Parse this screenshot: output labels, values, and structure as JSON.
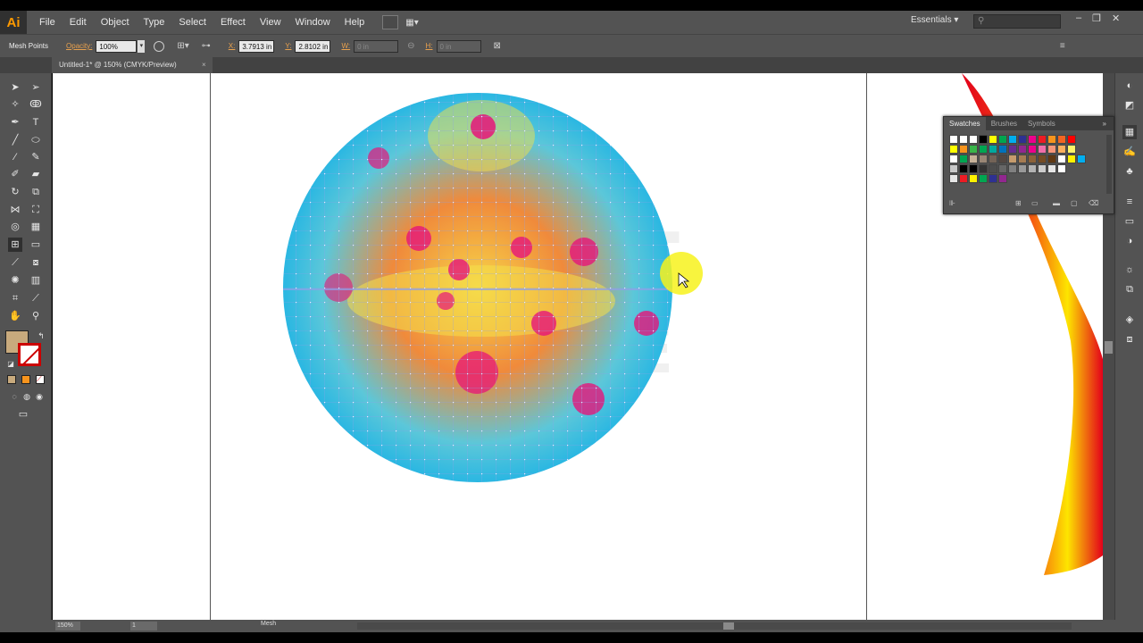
{
  "app": {
    "logo": "Ai"
  },
  "menu": [
    "File",
    "Edit",
    "Object",
    "Type",
    "Select",
    "Effect",
    "View",
    "Window",
    "Help"
  ],
  "workspace": {
    "label": "Essentials ▾"
  },
  "search": {
    "placeholder": ""
  },
  "control_bar": {
    "mode_label": "Mesh Points",
    "opacity_label": "Opacity:",
    "opacity_value": "100%",
    "x_label": "X:",
    "x_value": "3.7913 in",
    "y_label": "Y:",
    "y_value": "2.8102 in",
    "w_label": "W:",
    "w_value": "0 in",
    "h_label": "H:",
    "h_value": "0 in"
  },
  "document": {
    "tab_title": "Untitled-1* @ 150% (CMYK/Preview)",
    "close": "×"
  },
  "status": {
    "zoom": "150%",
    "page": "1",
    "tool": "Mesh"
  },
  "swatches_panel": {
    "tabs": [
      "Swatches",
      "Brushes",
      "Symbols"
    ],
    "colors_row1": [
      "#ffffff",
      "#000000",
      "#ffff00",
      "#00a650",
      "#00aeef",
      "#2e3192",
      "#ec008c",
      "#ed1c24",
      "#f7941d",
      "#f26522",
      "#ff0000"
    ],
    "colors_row2": [
      "#ffff00",
      "#f7941d",
      "#39b54a",
      "#00a651",
      "#00a99d",
      "#0072bc",
      "#662d91",
      "#92278f",
      "#ec008c",
      "#f06eaa",
      "#f69679",
      "#fbaf5d",
      "#fff568"
    ],
    "colors_row3": [
      "#c7b299",
      "#998675",
      "#736357",
      "#534741",
      "#c69c6d",
      "#a67c52",
      "#8c6239",
      "#754c24",
      "#603913",
      "#ffffff",
      "#fff200",
      "#00aeef"
    ],
    "grays": [
      "#000000",
      "#333333",
      "#4d4d4d",
      "#666666",
      "#808080",
      "#999999",
      "#b3b3b3",
      "#cccccc",
      "#e6e6e6",
      "#ffffff"
    ],
    "bottom": [
      "#ed1c24",
      "#fff200",
      "#00a651",
      "#2e3192",
      "#92278f"
    ]
  },
  "fill_color": "#c8aa7d"
}
